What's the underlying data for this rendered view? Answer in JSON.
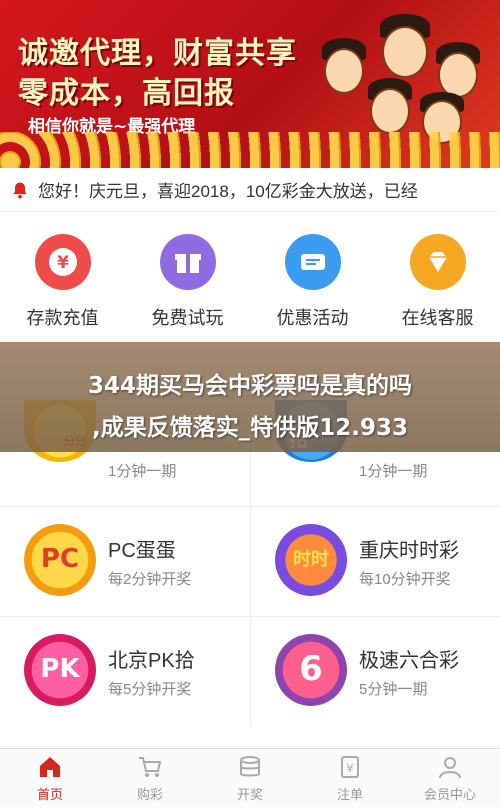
{
  "banner": {
    "line1": "诚邀代理，财富共享",
    "line2": "零成本，高回报",
    "line3": "相信你就是~最强代理"
  },
  "notice": {
    "text": "您好！庆元旦，喜迎2018，10亿彩金大放送，已经"
  },
  "quick_actions": [
    {
      "label": "存款充值",
      "icon": "yen-icon",
      "color": "#f04b4b"
    },
    {
      "label": "免费试玩",
      "icon": "gift-icon",
      "color": "#8e6be3"
    },
    {
      "label": "优惠活动",
      "icon": "ticket-icon",
      "color": "#3a9bf0"
    },
    {
      "label": "在线客服",
      "icon": "diamond-icon",
      "color": "#f5a623"
    }
  ],
  "overlay": {
    "line1": "344期买马会中彩票吗是真的吗",
    "line2": ",成果反馈落实_特供版12.933"
  },
  "games": [
    {
      "name": "",
      "sub": "1分钟一期",
      "badge": "分分"
    },
    {
      "name": "",
      "sub": "1分钟一期",
      "badge": "拾"
    },
    {
      "name": "PC蛋蛋",
      "sub": "每2分钟开奖",
      "badge": "PC"
    },
    {
      "name": "重庆时时彩",
      "sub": "每10分钟开奖",
      "badge": "时时"
    },
    {
      "name": "北京PK拾",
      "sub": "每5分钟开奖",
      "badge": "PK"
    },
    {
      "name": "极速六合彩",
      "sub": "5分钟一期",
      "badge": "6"
    }
  ],
  "tabs": [
    {
      "label": "首页",
      "active": true
    },
    {
      "label": "购彩",
      "active": false
    },
    {
      "label": "开奖",
      "active": false
    },
    {
      "label": "注单",
      "active": false
    },
    {
      "label": "会员中心",
      "active": false
    }
  ],
  "colors": {
    "accent": "#d9261c",
    "banner_red": "#d4171d",
    "coin_gold": "#ffd24a"
  }
}
